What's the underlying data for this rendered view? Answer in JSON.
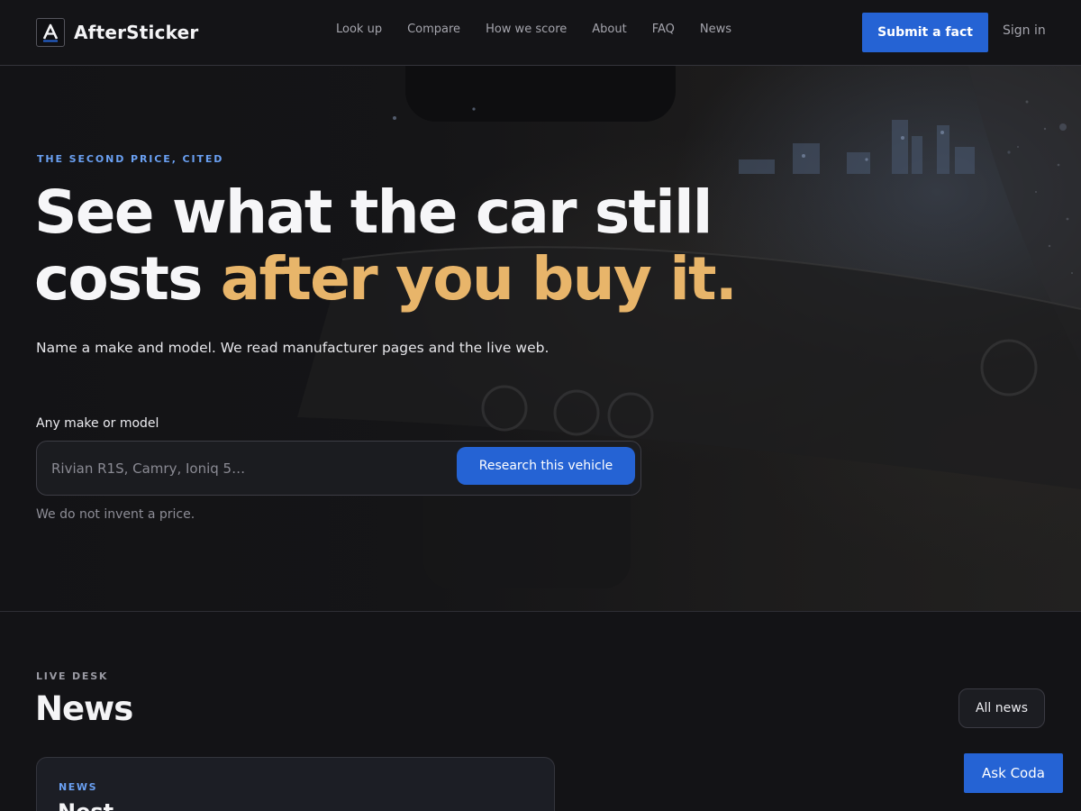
{
  "header": {
    "brand_name": "AfterSticker",
    "brand_icon": "logo-a-icon",
    "nav": [
      "Look up",
      "Compare",
      "How we score",
      "About",
      "FAQ",
      "News"
    ],
    "submit_label": "Submit a fact",
    "signin_label": "Sign in"
  },
  "hero": {
    "eyebrow": "THE SECOND PRICE, CITED",
    "headline_part1": "See what the car still costs ",
    "headline_accent": "after you buy it.",
    "subtitle": "Name a make and model. We read manufacturer pages and the live web.",
    "field_label": "Any make or model",
    "search_placeholder": "Rivian R1S, Camry, Ioniq 5…",
    "search_value": "",
    "search_button": "Research this vehicle",
    "disclaimer": "We do not invent a price."
  },
  "news": {
    "eyebrow": "LIVE DESK",
    "title": "News",
    "all_news_label": "All news",
    "card_tag": "NEWS",
    "card_title": "Nest…"
  },
  "chat": {
    "ask_label": "Ask Coda"
  },
  "colors": {
    "accent_blue": "#2563d4",
    "accent_gold": "#e8b56a",
    "eyebrow_blue": "#6aa0f2",
    "background": "#131316"
  }
}
